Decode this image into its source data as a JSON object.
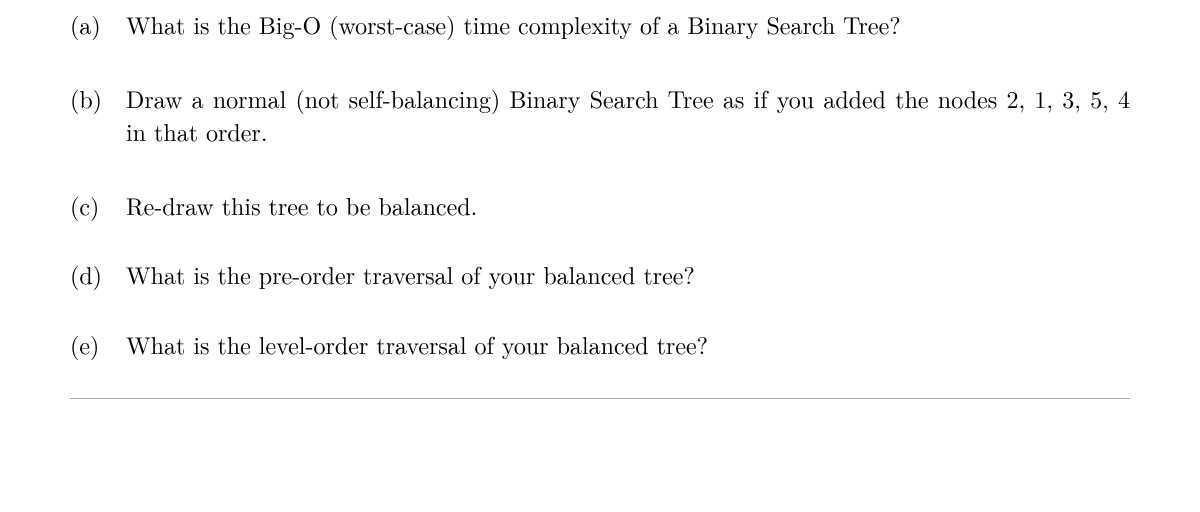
{
  "questions": [
    {
      "label": "(a)",
      "text": "What is the Big-O (worst-case) time complexity of a Binary Search Tree?"
    },
    {
      "label": "(b)",
      "text": "Draw a normal (not self-balancing) Binary Search Tree as if you added the nodes 2, 1, 3, 5, 4 in that order."
    },
    {
      "label": "(c)",
      "text": "Re-draw this tree to be balanced."
    },
    {
      "label": "(d)",
      "text": "What is the pre-order traversal of your balanced tree?"
    },
    {
      "label": "(e)",
      "text": "What is the level-order traversal of your balanced tree?"
    }
  ]
}
